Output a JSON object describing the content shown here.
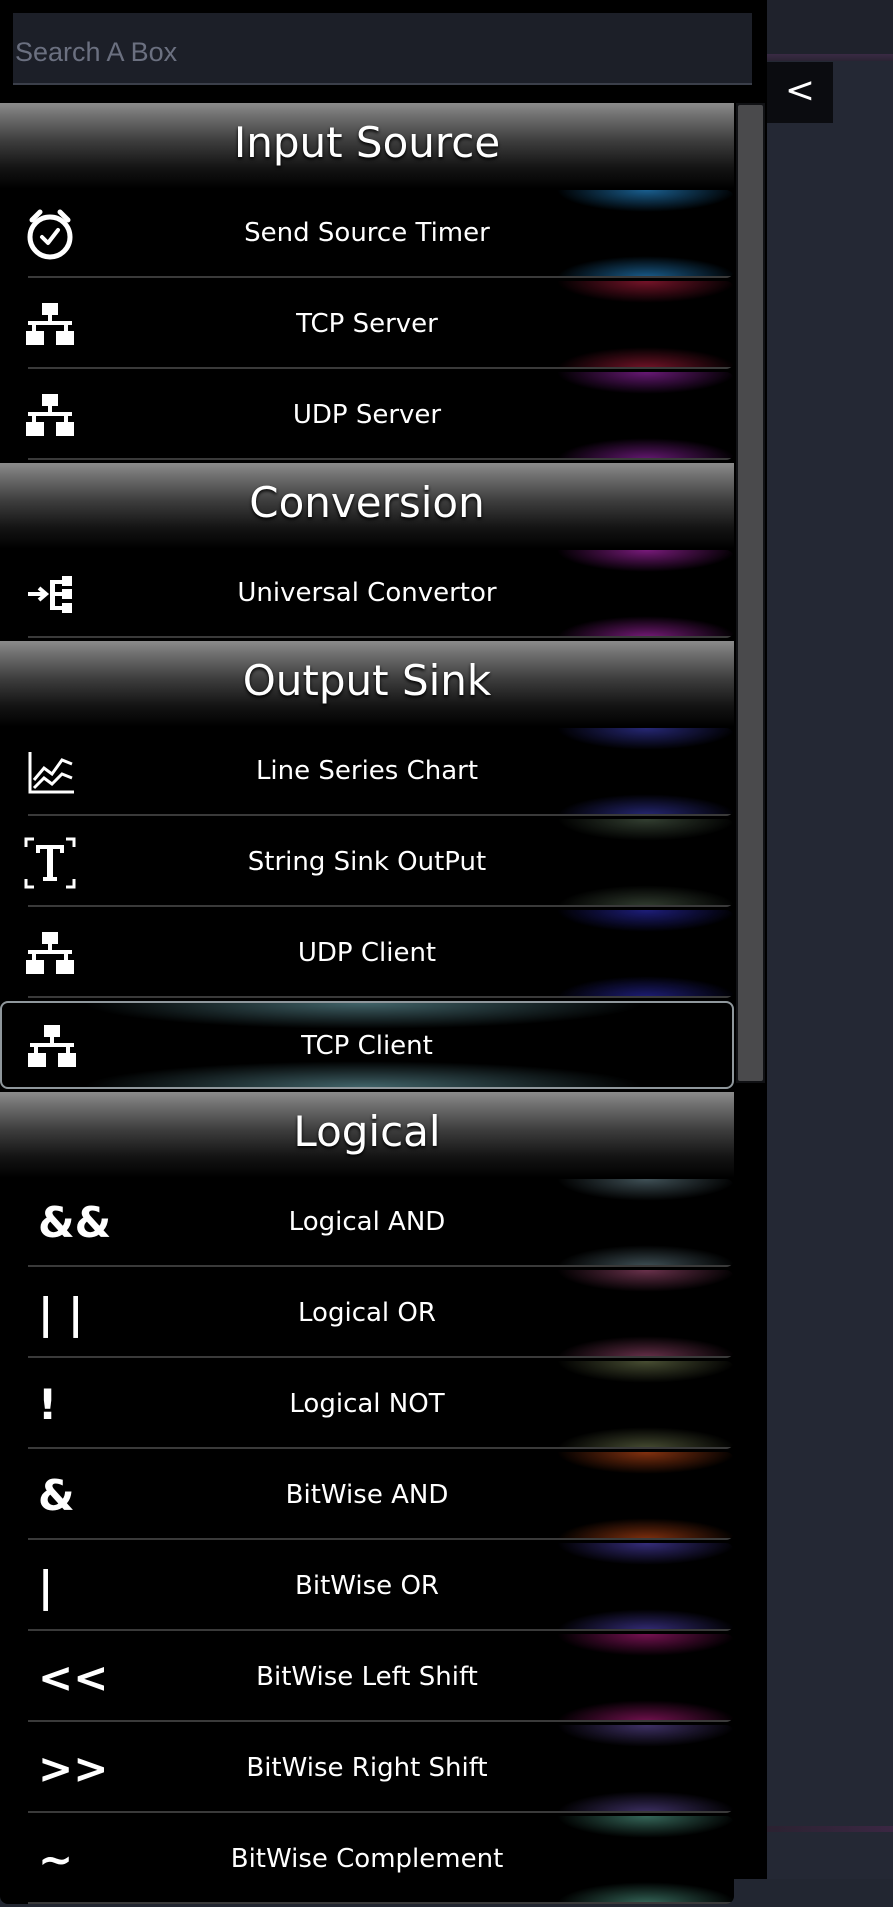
{
  "search": {
    "placeholder": "Search A Box",
    "value": ""
  },
  "collapse": {
    "label": "<"
  },
  "groups": [
    {
      "title": "Input Source",
      "items": [
        {
          "label": "Send Source Timer",
          "icon": "timer-icon",
          "color": "#1e6fa8"
        },
        {
          "label": "TCP Server",
          "icon": "network-icon",
          "color": "#8a1730"
        },
        {
          "label": "UDP Server",
          "icon": "network-icon",
          "color": "#7a1d8a"
        }
      ]
    },
    {
      "title": "Conversion",
      "items": [
        {
          "label": "Universal Convertor",
          "icon": "convert-icon",
          "color": "#8d1f90"
        }
      ]
    },
    {
      "title": "Output Sink",
      "items": [
        {
          "label": "Line Series Chart",
          "icon": "line-chart-icon",
          "color": "#2d2f8a"
        },
        {
          "label": "String Sink OutPut",
          "icon": "text-icon",
          "color": "#3c4a3a"
        },
        {
          "label": "UDP Client",
          "icon": "network-icon",
          "color": "#23238f"
        },
        {
          "label": "TCP Client",
          "icon": "network-icon",
          "color": "#5d8e96"
        }
      ]
    },
    {
      "title": "Logical",
      "items": [
        {
          "label": "Logical AND",
          "symbol": "&&",
          "color": "#4b5f66"
        },
        {
          "label": "Logical OR",
          "symbol": "| |",
          "color": "#7c3a59"
        },
        {
          "label": "Logical NOT",
          "symbol": "!",
          "color": "#555c3c"
        },
        {
          "label": "BitWise AND",
          "symbol": "&",
          "color": "#9a3a12"
        },
        {
          "label": "BitWise OR",
          "symbol": "|",
          "color": "#3f3590"
        },
        {
          "label": "BitWise Left Shift",
          "symbol": "<<",
          "color": "#8a1560"
        },
        {
          "label": "BitWise Right Shift",
          "symbol": ">>",
          "color": "#4a3a78"
        },
        {
          "label": "BitWise Complement",
          "symbol": "~",
          "color": "#3f7a6a"
        }
      ]
    }
  ]
}
